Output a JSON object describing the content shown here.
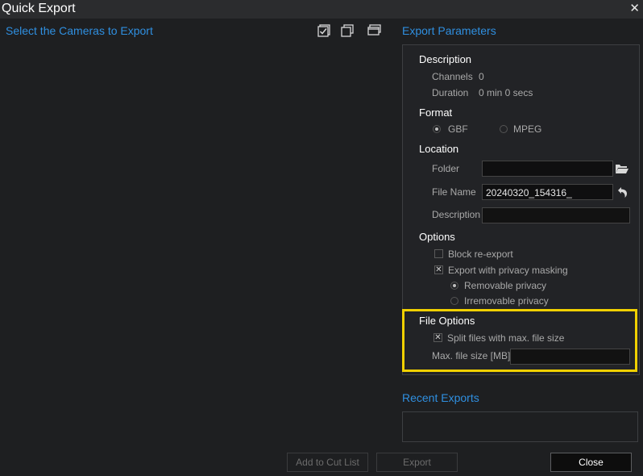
{
  "window": {
    "title": "Quick Export",
    "close_glyph": "✕"
  },
  "left": {
    "heading": "Select the Cameras to Export",
    "icons": [
      "select-all-icon",
      "copy-windows-icon",
      "window-stack-icon"
    ]
  },
  "params": {
    "heading": "Export Parameters",
    "description": {
      "header": "Description",
      "channels_label": "Channels",
      "channels_value": "0",
      "duration_label": "Duration",
      "duration_value": "0 min 0 secs"
    },
    "format": {
      "header": "Format",
      "options": [
        "GBF",
        "MPEG"
      ],
      "selected": "GBF"
    },
    "location": {
      "header": "Location",
      "folder_label": "Folder",
      "folder_value": "",
      "filename_label": "File Name",
      "filename_value": "20240320_154316_",
      "description_label": "Description",
      "description_value": ""
    },
    "options": {
      "header": "Options",
      "block_reexport": "Block re-export",
      "privacy_masking": "Export with privacy masking",
      "removable": "Removable privacy",
      "irremovable": "Irremovable privacy"
    },
    "file_options": {
      "header": "File Options",
      "split_label": "Split files with max. file size",
      "max_size_label": "Max. file size [MB]",
      "max_size_value": ""
    }
  },
  "recent": {
    "heading": "Recent Exports"
  },
  "buttons": {
    "add_cut": "Add to Cut List",
    "export": "Export",
    "close": "Close"
  },
  "colors": {
    "accent": "#2f8fe0",
    "highlight": "#f0d000",
    "bg": "#1e1f21"
  }
}
